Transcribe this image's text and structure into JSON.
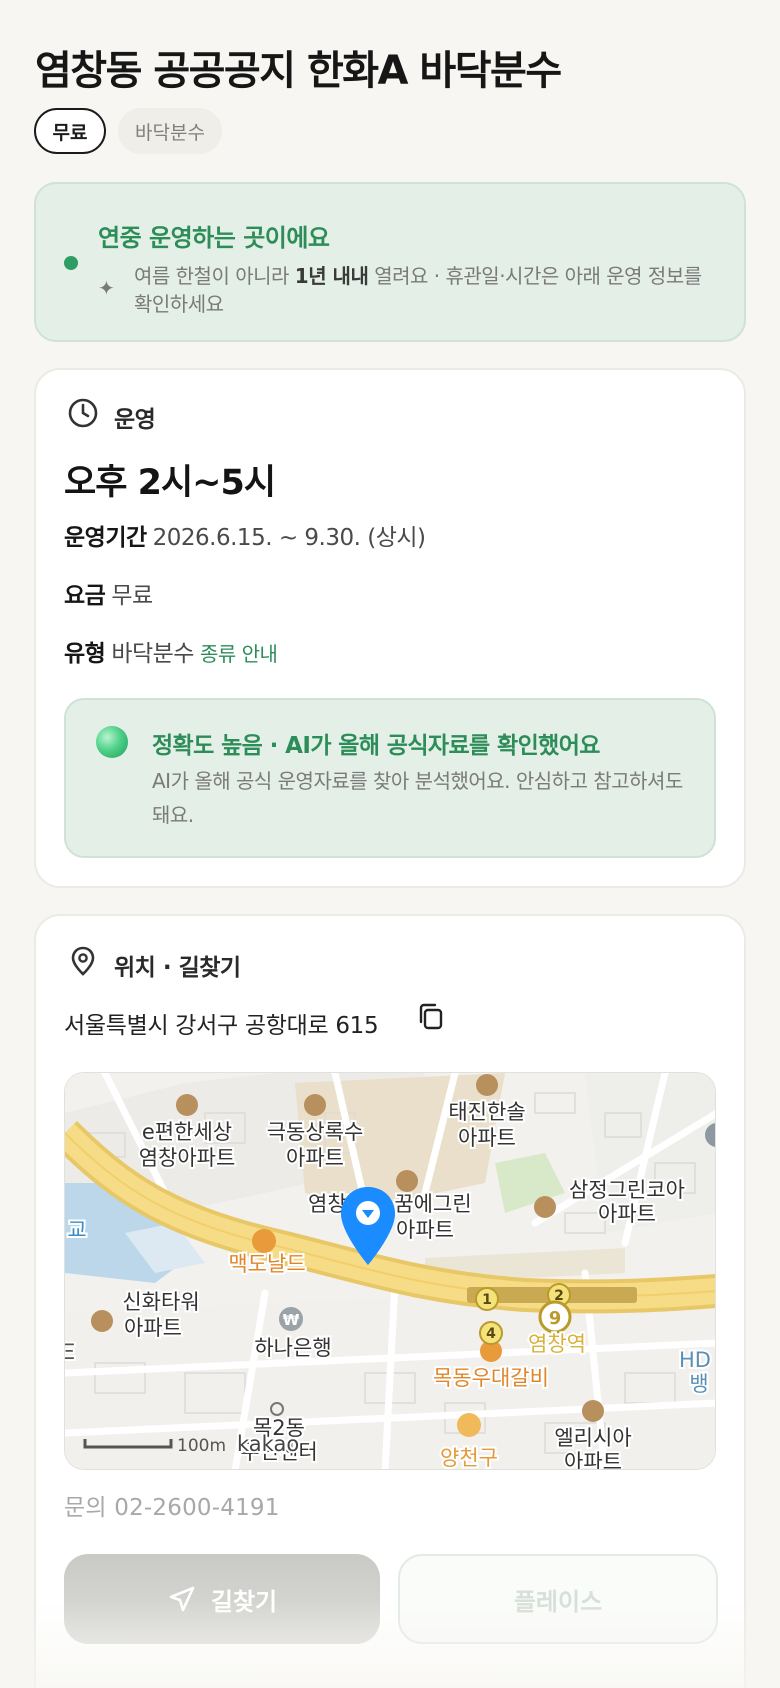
{
  "header": {
    "title": "염창동 공공공지 한화A 바닥분수",
    "chips": [
      "무료",
      "바닥분수"
    ]
  },
  "banner": {
    "title": "연중 운영하는 곳이에요",
    "text_before": "여름 한철이 아니라 ",
    "text_bold": "1년 내내",
    "text_after": " 열려요 · 휴관일·시간은 아래 운영 정보를 확인하세요"
  },
  "hours": {
    "section_label": "운영",
    "value": "오후 2시~5시",
    "period_label": "운영기간",
    "period_value": "2026.6.15. ~ 9.30. (상시)",
    "fee_label": "요금",
    "fee_value": "무료",
    "type_label": "유형",
    "type_value": "바닥분수",
    "type_link": "종류 안내"
  },
  "accuracy": {
    "title": "정확도 높음 · AI가 올해 공식자료를 확인했어요",
    "text": "AI가 올해 공식 운영자료를 찾아 분석했어요. 안심하고 참고하셔도 돼요."
  },
  "location": {
    "section_label": "위치 · 길찾기",
    "address": "서울특별시 강서구 공항대로 615",
    "map": {
      "labels": {
        "apt1a": "e편한세상",
        "apt1b": "염창아파트",
        "apt2a": "극동상록수",
        "apt2b": "아파트",
        "apt3a": "태진한솔",
        "apt3b": "아파트",
        "apt4a": "염창한",
        "apt4b": "꿈에그린",
        "apt4c": "1",
        "apt4d": "아파트",
        "apt5a": "삼정그린코아",
        "apt5b": "아파트",
        "mcd": "맥도날드",
        "apt6a": "신화타워",
        "apt6b": "아파트",
        "bank": "하나은행",
        "station": "염창역",
        "restaurant": "목동우대갈비",
        "gu": "양천구",
        "dong1": "목2동",
        "dong2": "주민센터",
        "apt7a": "엘리시아",
        "apt7b": "아파트",
        "hd1": "HD",
        "hd2": "뱅",
        "left_edge": "교",
        "scale": "100m",
        "brand": "kakao",
        "line9": "9",
        "exit1": "1",
        "exit2": "2",
        "exit4": "4",
        "won": "₩",
        "edge_mark": "Ξ"
      }
    },
    "phone": "문의 02-2600-4191"
  },
  "actions": {
    "route_label": "길찾기",
    "place_label": "플레이스"
  },
  "colors": {
    "accent_green": "#2d8d58",
    "banner_bg": "#e4efe8",
    "page_bg": "#f7f6f2",
    "pin_blue": "#1a8cff",
    "road_yellow": "#f7dc87"
  }
}
